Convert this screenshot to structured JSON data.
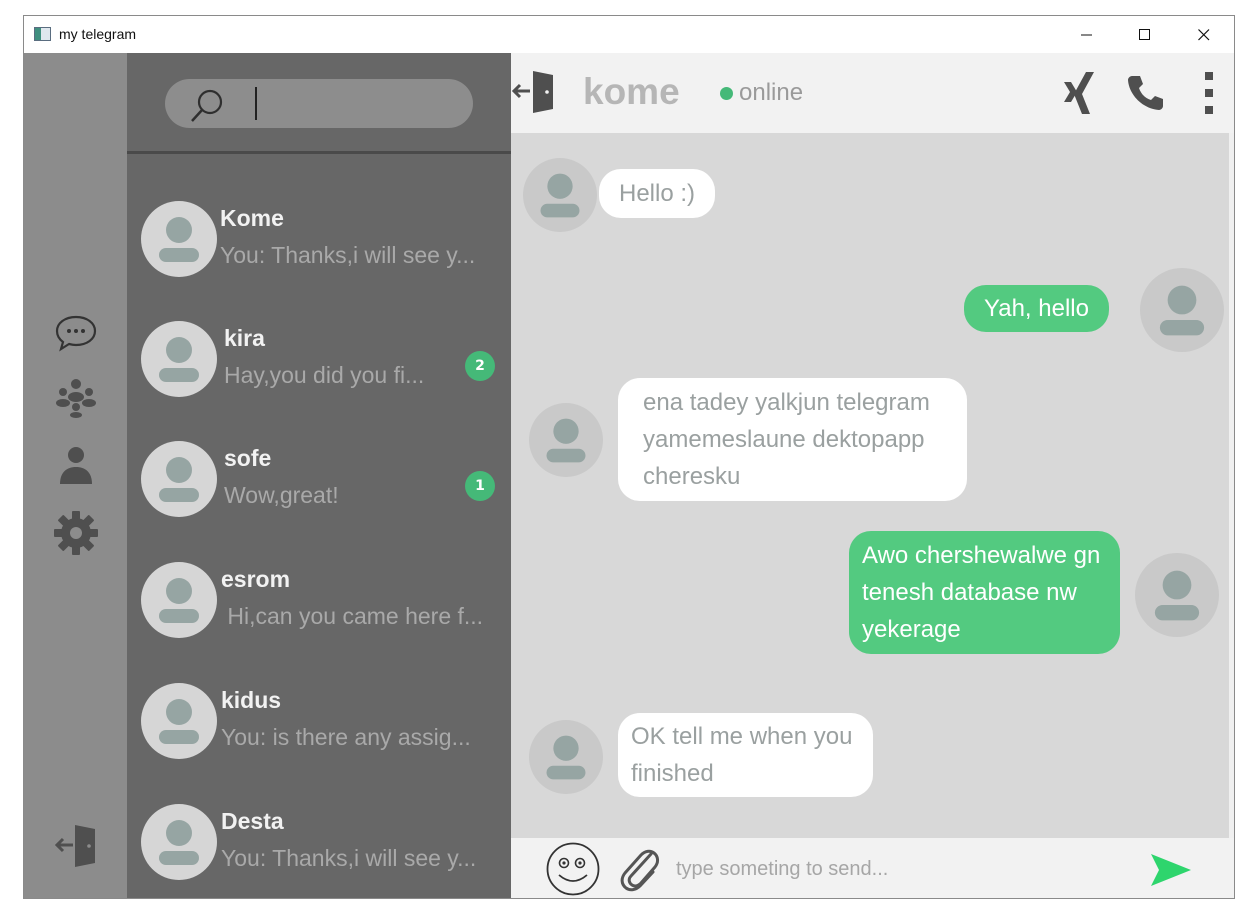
{
  "window": {
    "title": "my telegram"
  },
  "search": {
    "placeholder": "",
    "value": ""
  },
  "chats": [
    {
      "name": "Kome",
      "preview": "You: Thanks,i will see y...",
      "unread": ""
    },
    {
      "name": "kira",
      "preview": "Hay,you did you fi...",
      "unread": "2"
    },
    {
      "name": "sofe",
      "preview": "Wow,great!",
      "unread": "1"
    },
    {
      "name": "esrom",
      "preview": " Hi,can you came here f...",
      "unread": ""
    },
    {
      "name": "kidus",
      "preview": "You: is there any assig...",
      "unread": ""
    },
    {
      "name": "Desta",
      "preview": "You: Thanks,i will see y...",
      "unread": ""
    }
  ],
  "conversation": {
    "contact": "kome",
    "status": "online",
    "messages": [
      {
        "dir": "in",
        "lines": [
          "Hello :)"
        ]
      },
      {
        "dir": "out",
        "lines": [
          "Yah, hello"
        ]
      },
      {
        "dir": "in",
        "lines": [
          "ena tadey yalkjun telegram",
          "yamemeslaune dektopapp",
          "cheresku"
        ]
      },
      {
        "dir": "out",
        "lines": [
          "Awo chershewalwe gn",
          "tenesh database nw",
          "yekerage"
        ]
      },
      {
        "dir": "in",
        "lines": [
          "OK tell me when you",
          "finished"
        ]
      }
    ]
  },
  "composer": {
    "placeholder": "type someting to send..."
  },
  "colors": {
    "accent": "#53ca80",
    "online": "#45b978",
    "rail": "#8c8c8c",
    "list": "#676767"
  },
  "icons": [
    "chats-icon",
    "groups-icon",
    "contacts-icon",
    "settings-icon",
    "logout-icon",
    "search-icon",
    "back-icon",
    "xing-icon",
    "phone-icon",
    "more-icon",
    "emoji-icon",
    "attach-icon",
    "send-icon"
  ]
}
